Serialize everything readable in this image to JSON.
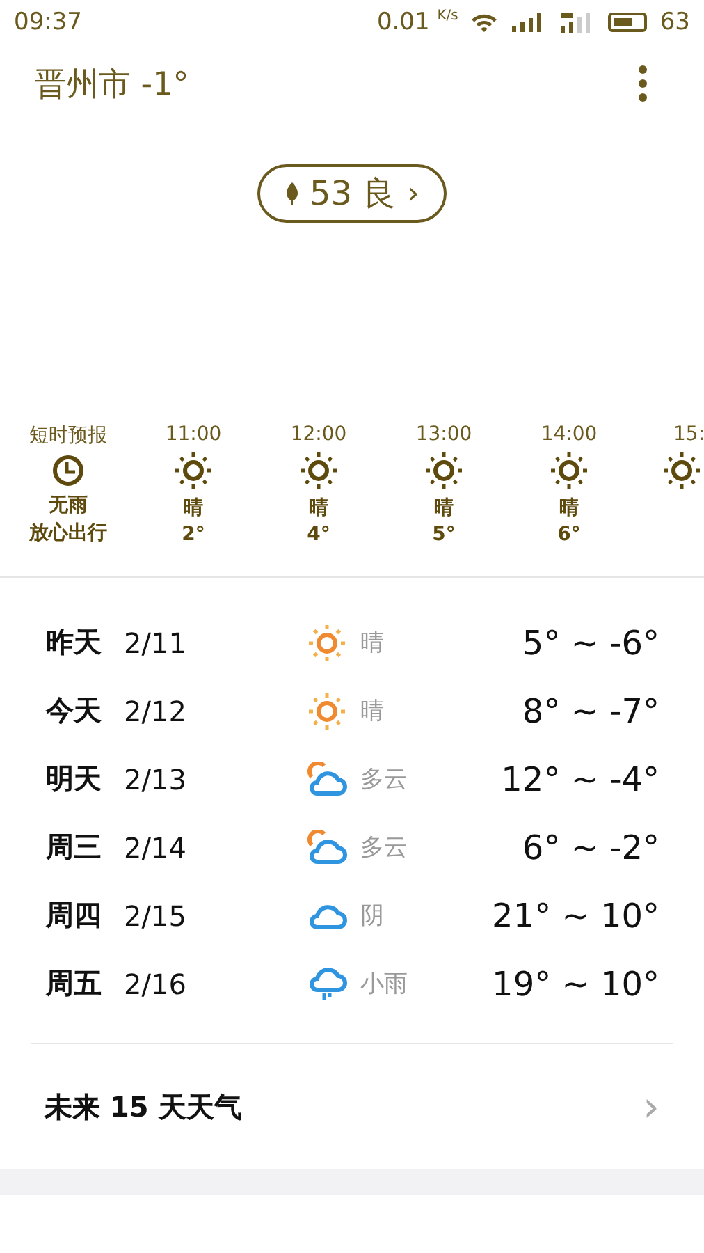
{
  "status_bar": {
    "time": "09:37",
    "speed": "0.01",
    "speed_unit": "K/s",
    "battery": "63"
  },
  "header": {
    "title": "晋州市 -1°"
  },
  "aqi": {
    "value": "53",
    "label": "良",
    "arrow": "›"
  },
  "hourly": [
    {
      "time": "短时预报",
      "kind": "clock",
      "cond": "无雨",
      "temp": "放心出行"
    },
    {
      "time": "11:00",
      "kind": "sunny",
      "cond": "晴",
      "temp": "2°"
    },
    {
      "time": "12:00",
      "kind": "sunny",
      "cond": "晴",
      "temp": "4°"
    },
    {
      "time": "13:00",
      "kind": "sunny",
      "cond": "晴",
      "temp": "5°"
    },
    {
      "time": "14:00",
      "kind": "sunny",
      "cond": "晴",
      "temp": "6°"
    },
    {
      "time": "15:",
      "kind": "sunny"
    }
  ],
  "daily": [
    {
      "day": "昨天",
      "date": "2/11",
      "kind": "sunny",
      "cond": "晴",
      "range": "5° ~ -6°"
    },
    {
      "day": "今天",
      "date": "2/12",
      "kind": "sunny",
      "cond": "晴",
      "range": "8° ~ -7°"
    },
    {
      "day": "明天",
      "date": "2/13",
      "kind": "partly_cloudy",
      "cond": "多云",
      "range": "12° ~ -4°"
    },
    {
      "day": "周三",
      "date": "2/14",
      "kind": "partly_cloudy",
      "cond": "多云",
      "range": "6° ~ -2°"
    },
    {
      "day": "周四",
      "date": "2/15",
      "kind": "cloudy",
      "cond": "阴",
      "range": "21° ~ 10°"
    },
    {
      "day": "周五",
      "date": "2/16",
      "kind": "rain",
      "cond": "小雨",
      "range": "19° ~ 10°"
    }
  ],
  "more": {
    "label": "未来 15 天天气",
    "arrow": "›"
  }
}
